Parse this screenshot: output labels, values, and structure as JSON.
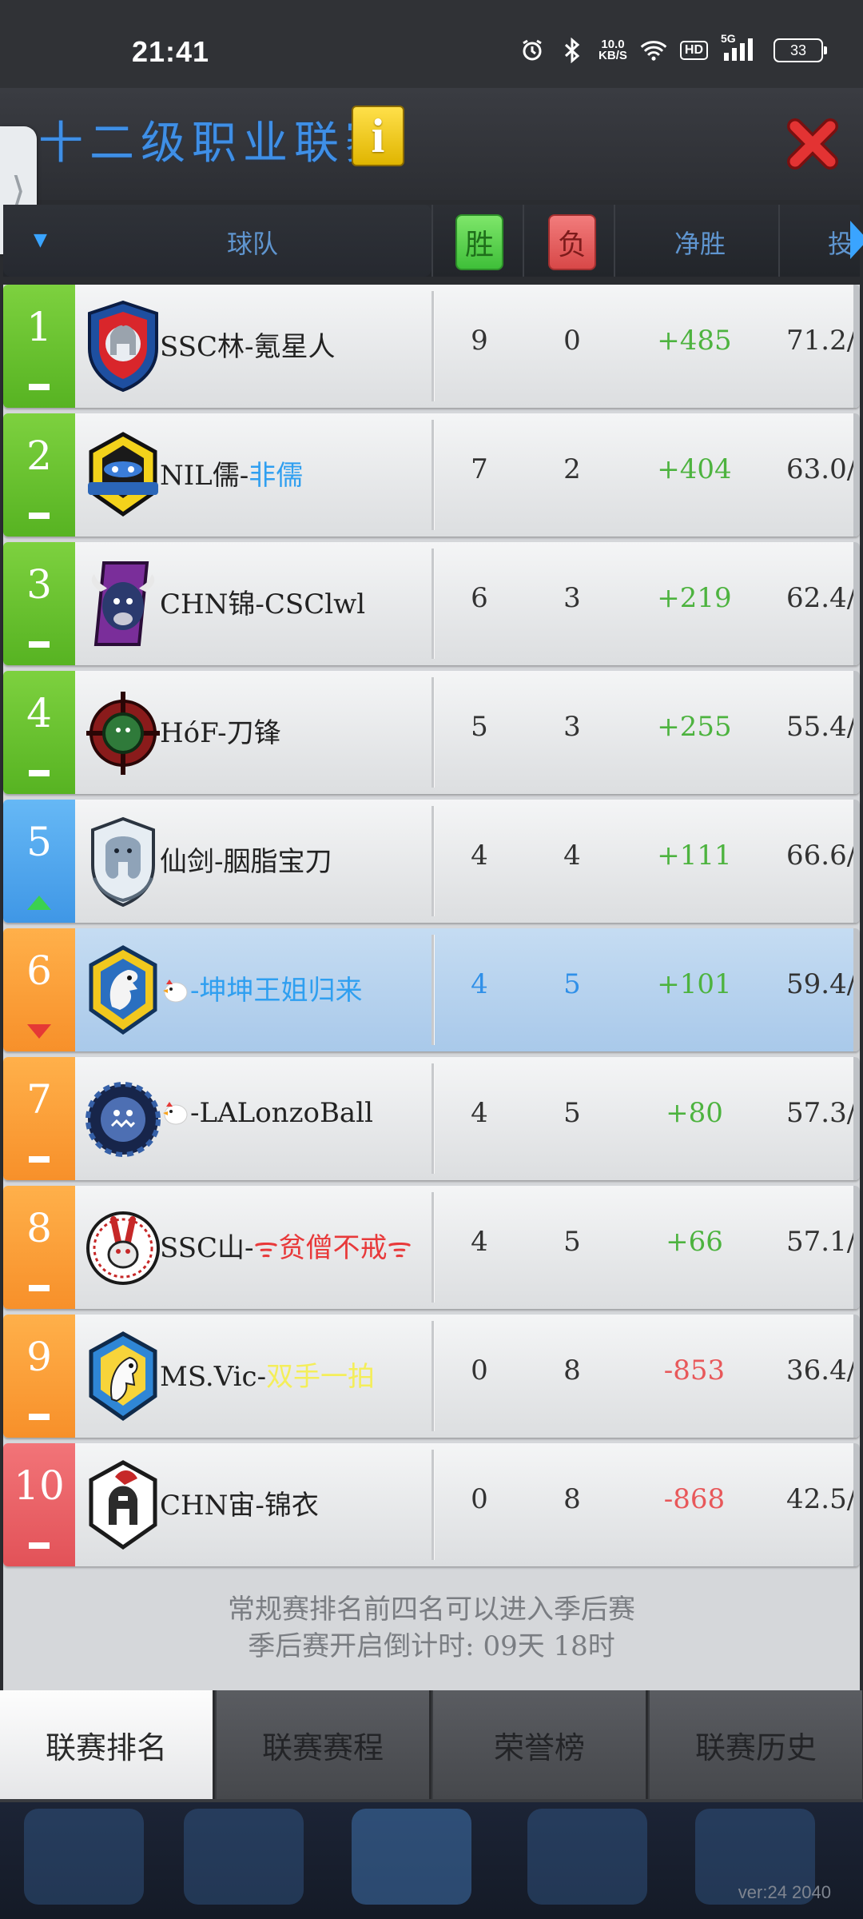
{
  "status_bar": {
    "time": "21:41",
    "net_speed_top": "10.0",
    "net_speed_bottom": "KB/S",
    "hd": "HD",
    "signal": "5G",
    "battery": "33"
  },
  "header": {
    "title": "十二级职业联赛",
    "info_label": "i",
    "side_tab_glyph": "⟩"
  },
  "table_header": {
    "team": "球队",
    "win": "胜",
    "loss": "负",
    "net": "净胜",
    "more": "投"
  },
  "rows": [
    {
      "rank": "1",
      "name": "SSC林-氪星人",
      "win": "9",
      "loss": "0",
      "net": "+485",
      "pct": "71.2/"
    },
    {
      "rank": "2",
      "name_prefix": "NIL儒-",
      "name_sub": "非儒",
      "win": "7",
      "loss": "2",
      "net": "+404",
      "pct": "63.0/"
    },
    {
      "rank": "3",
      "name": "CHN锦-CSClwl",
      "win": "6",
      "loss": "3",
      "net": "+219",
      "pct": "62.4/"
    },
    {
      "rank": "4",
      "name": "HóF-刀锋",
      "win": "5",
      "loss": "3",
      "net": "+255",
      "pct": "55.4/"
    },
    {
      "rank": "5",
      "name": "仙剑-胭脂宝刀",
      "win": "4",
      "loss": "4",
      "net": "+111",
      "pct": "66.6/"
    },
    {
      "rank": "6",
      "name": "-坤坤王姐归来",
      "win": "4",
      "loss": "5",
      "net": "+101",
      "pct": "59.4/"
    },
    {
      "rank": "7",
      "name": "-LALonzoBall",
      "win": "4",
      "loss": "5",
      "net": "+80",
      "pct": "57.3/"
    },
    {
      "rank": "8",
      "name_prefix": "SSC山-",
      "name_sub": "ᯤ贫僧不戒ᯤ",
      "win": "4",
      "loss": "5",
      "net": "+66",
      "pct": "57.1/"
    },
    {
      "rank": "9",
      "name_prefix": "MS.Vic-",
      "name_sub": "双手一拍",
      "win": "0",
      "loss": "8",
      "net": "-853",
      "pct": "36.4/"
    },
    {
      "rank": "10",
      "name": "CHN宙-锦衣",
      "win": "0",
      "loss": "8",
      "net": "-868",
      "pct": "42.5/"
    }
  ],
  "notice": {
    "line1": "常规赛排名前四名可以进入季后赛",
    "line2": "季后赛开启倒计时: 09天 18时"
  },
  "tabs": [
    "联赛排名",
    "联赛赛程",
    "荣誉榜",
    "联赛历史"
  ],
  "version": "ver:24 2040",
  "colors": {
    "rank_green": "#6cc230",
    "rank_blue": "#4ea8ef",
    "rank_orange": "#f89c36",
    "rank_red": "#e8606a",
    "positive": "#4db33f",
    "negative": "#e8585a",
    "title_blue": "#3f8fe6"
  }
}
